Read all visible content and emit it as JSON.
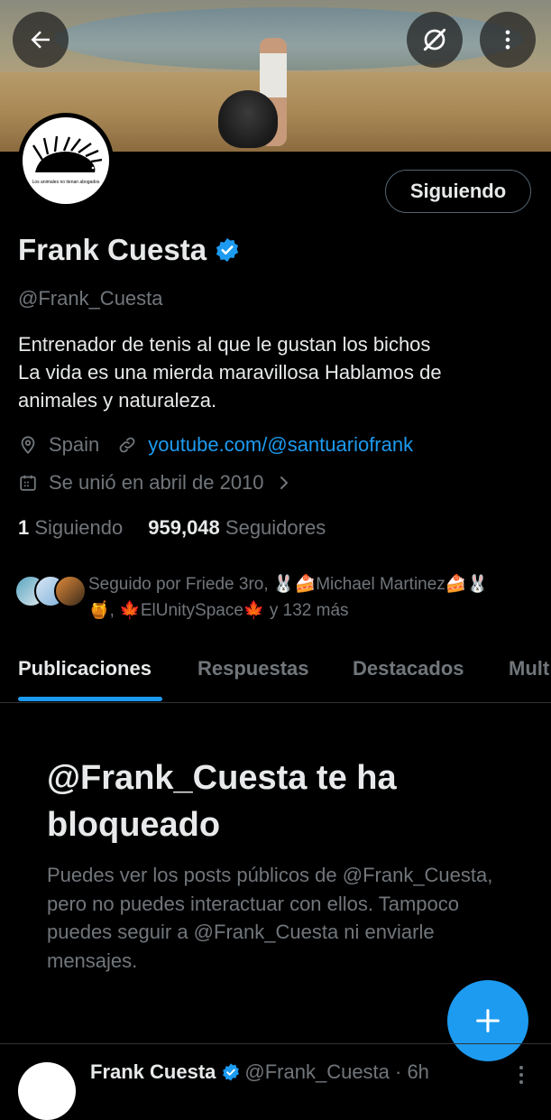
{
  "header": {
    "back_icon": "arrow-left-icon",
    "grok_icon": "slash-circle-icon",
    "more_icon": "vertical-dots-icon"
  },
  "profile": {
    "avatar_caption": "Los animales no tienan abogados",
    "follow_button_label": "Siguiendo",
    "name": "Frank Cuesta",
    "handle": "@Frank_Cuesta",
    "bio_lines": [
      "Entrenador de tenis al que le gustan los bichos",
      "La vida es una mierda maravillosa Hablamos de",
      "animales y naturaleza."
    ],
    "location": "Spain",
    "website": "youtube.com/@santuariofrank",
    "joined": "Se unió en abril de 2010",
    "following_count": "1",
    "following_label": "Siguiendo",
    "followers_count": "959,048",
    "followers_label": "Seguidores",
    "followed_by_line1": "Seguido por Friede 3ro, 🐰🍰Michael Martinez🍰🐰",
    "followed_by_line2": "🍯, 🍁ElUnitySpace🍁 y 132 más"
  },
  "tabs": [
    "Publicaciones",
    "Respuestas",
    "Destacados",
    "Mult"
  ],
  "blocked": {
    "title": "@Frank_Cuesta te ha bloqueado",
    "description": "Puedes ver los posts públicos de @Frank_Cuesta, pero no puedes interactuar con ellos. Tampoco puedes seguir a @Frank_Cuesta ni enviarle mensajes."
  },
  "fab_icon": "plus-icon",
  "post_preview": {
    "name": "Frank Cuesta",
    "handle_time": "@Frank_Cuesta · 6h"
  },
  "colors": {
    "background": "#000000",
    "accent": "#1d9bf0",
    "muted_text": "#71767b",
    "primary_text": "#e7e9ea",
    "border": "#2f3336"
  }
}
